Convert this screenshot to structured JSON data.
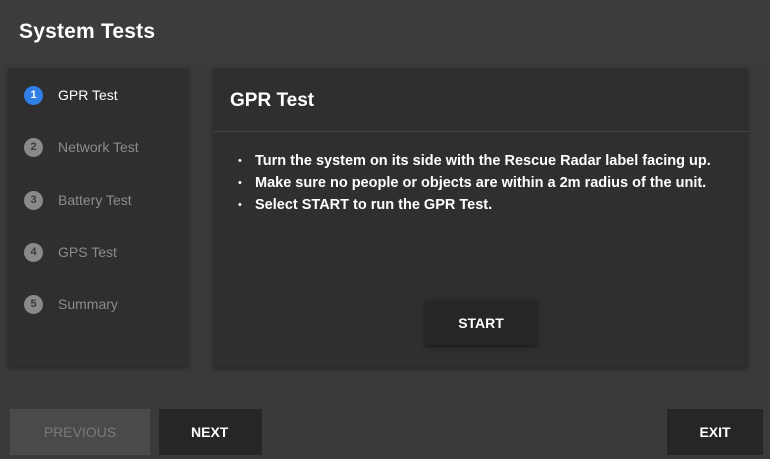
{
  "app": {
    "title": "System Tests"
  },
  "steps": [
    {
      "number": "1",
      "label": "GPR Test",
      "active": true
    },
    {
      "number": "2",
      "label": "Network Test",
      "active": false
    },
    {
      "number": "3",
      "label": "Battery Test",
      "active": false
    },
    {
      "number": "4",
      "label": "GPS Test",
      "active": false
    },
    {
      "number": "5",
      "label": "Summary",
      "active": false
    }
  ],
  "panel": {
    "title": "GPR Test",
    "instructions": [
      "Turn the system on its side with the Rescue Radar label facing up.",
      "Make sure no people or objects are within a 2m radius of the unit.",
      "Select START to run the GPR Test."
    ],
    "start_label": "START"
  },
  "footer": {
    "previous_label": "PREVIOUS",
    "next_label": "NEXT",
    "exit_label": "EXIT"
  },
  "colors": {
    "background": "#3a3a3a",
    "panel": "#2f2f2f",
    "button": "#262626",
    "active_step": "#2f7fe6",
    "inactive_step": "#8a8a8a",
    "disabled_button": "#4a4a4a"
  }
}
